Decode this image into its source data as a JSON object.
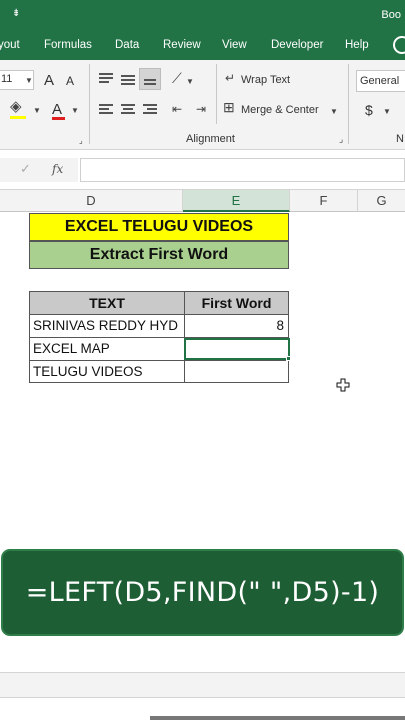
{
  "titlebar": {
    "quick_access": "⇟",
    "title": "Boo"
  },
  "ribbon_tabs": [
    "yout",
    "Formulas",
    "Data",
    "Review",
    "View",
    "Developer",
    "Help"
  ],
  "ribbon": {
    "font_size": "11",
    "font_grow": "A",
    "font_shrink": "A",
    "wrap_text": "Wrap Text",
    "merge_center": "Merge & Center",
    "alignment_group": "Alignment",
    "number_format": "General",
    "number_group_partial": "N",
    "currency": "$"
  },
  "formula_bar": {
    "cancel": "✓",
    "fx": "fx",
    "value": ""
  },
  "columns": [
    "D",
    "E",
    "F",
    "G"
  ],
  "title_cells": {
    "line1": "EXCEL TELUGU VIDEOS",
    "line2": "Extract First Word"
  },
  "table": {
    "headers": [
      "TEXT",
      "First Word"
    ],
    "rows": [
      {
        "text": "SRINIVAS REDDY HYD",
        "first_word": "8"
      },
      {
        "text": "EXCEL MAP",
        "first_word": ""
      },
      {
        "text": "TELUGU VIDEOS",
        "first_word": ""
      }
    ]
  },
  "active_cell": "E5",
  "banner": {
    "formula": "=LEFT(D5,FIND(\" \",D5)-1)"
  },
  "colors": {
    "excel_green": "#217346",
    "yellow": "#ffff00",
    "light_green": "#a9d08e",
    "header_gray": "#c9c9c9",
    "banner_green": "#1e5e35"
  }
}
